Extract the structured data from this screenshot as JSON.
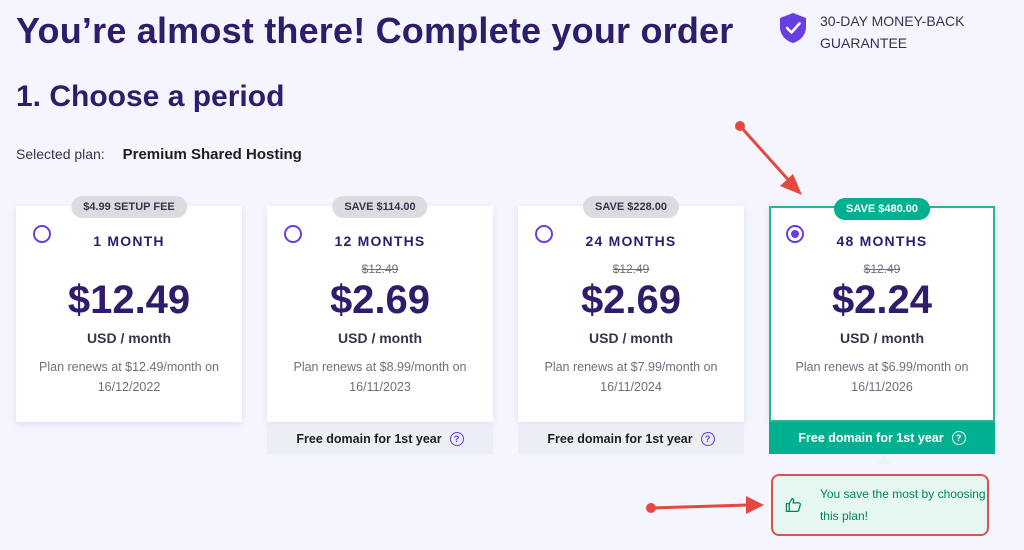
{
  "header": {
    "title": "You’re almost there! Complete your order",
    "guarantee": "30-DAY MONEY-BACK GUARANTEE"
  },
  "section": {
    "title": "1. Choose a period",
    "selected_label": "Selected plan:",
    "selected_plan": "Premium Shared Hosting"
  },
  "plans": [
    {
      "badge": "$4.99 SETUP FEE",
      "period": "1 MONTH",
      "old_price": "",
      "price": "$12.49",
      "unit": "USD / month",
      "renew": "Plan renews at $12.49/month on 16/12/2022",
      "footer": "",
      "selected": false
    },
    {
      "badge": "SAVE $114.00",
      "period": "12 MONTHS",
      "old_price": "$12.49",
      "price": "$2.69",
      "unit": "USD / month",
      "renew": "Plan renews at $8.99/month on 16/11/2023",
      "footer": "Free domain for 1st year",
      "selected": false
    },
    {
      "badge": "SAVE $228.00",
      "period": "24 MONTHS",
      "old_price": "$12.49",
      "price": "$2.69",
      "unit": "USD / month",
      "renew": "Plan renews at $7.99/month on 16/11/2024",
      "footer": "Free domain for 1st year",
      "selected": false
    },
    {
      "badge": "SAVE $480.00",
      "period": "48 MONTHS",
      "old_price": "$12.49",
      "price": "$2.24",
      "unit": "USD / month",
      "renew": "Plan renews at $6.99/month on 16/11/2026",
      "footer": "Free domain for 1st year",
      "selected": true
    }
  ],
  "save_note": "You save the most by choosing this plan!",
  "help_glyph": "?",
  "colors": {
    "brand": "#673de6",
    "heading": "#2f1c6a",
    "success": "#00b090",
    "annotation": "#e5483f"
  }
}
